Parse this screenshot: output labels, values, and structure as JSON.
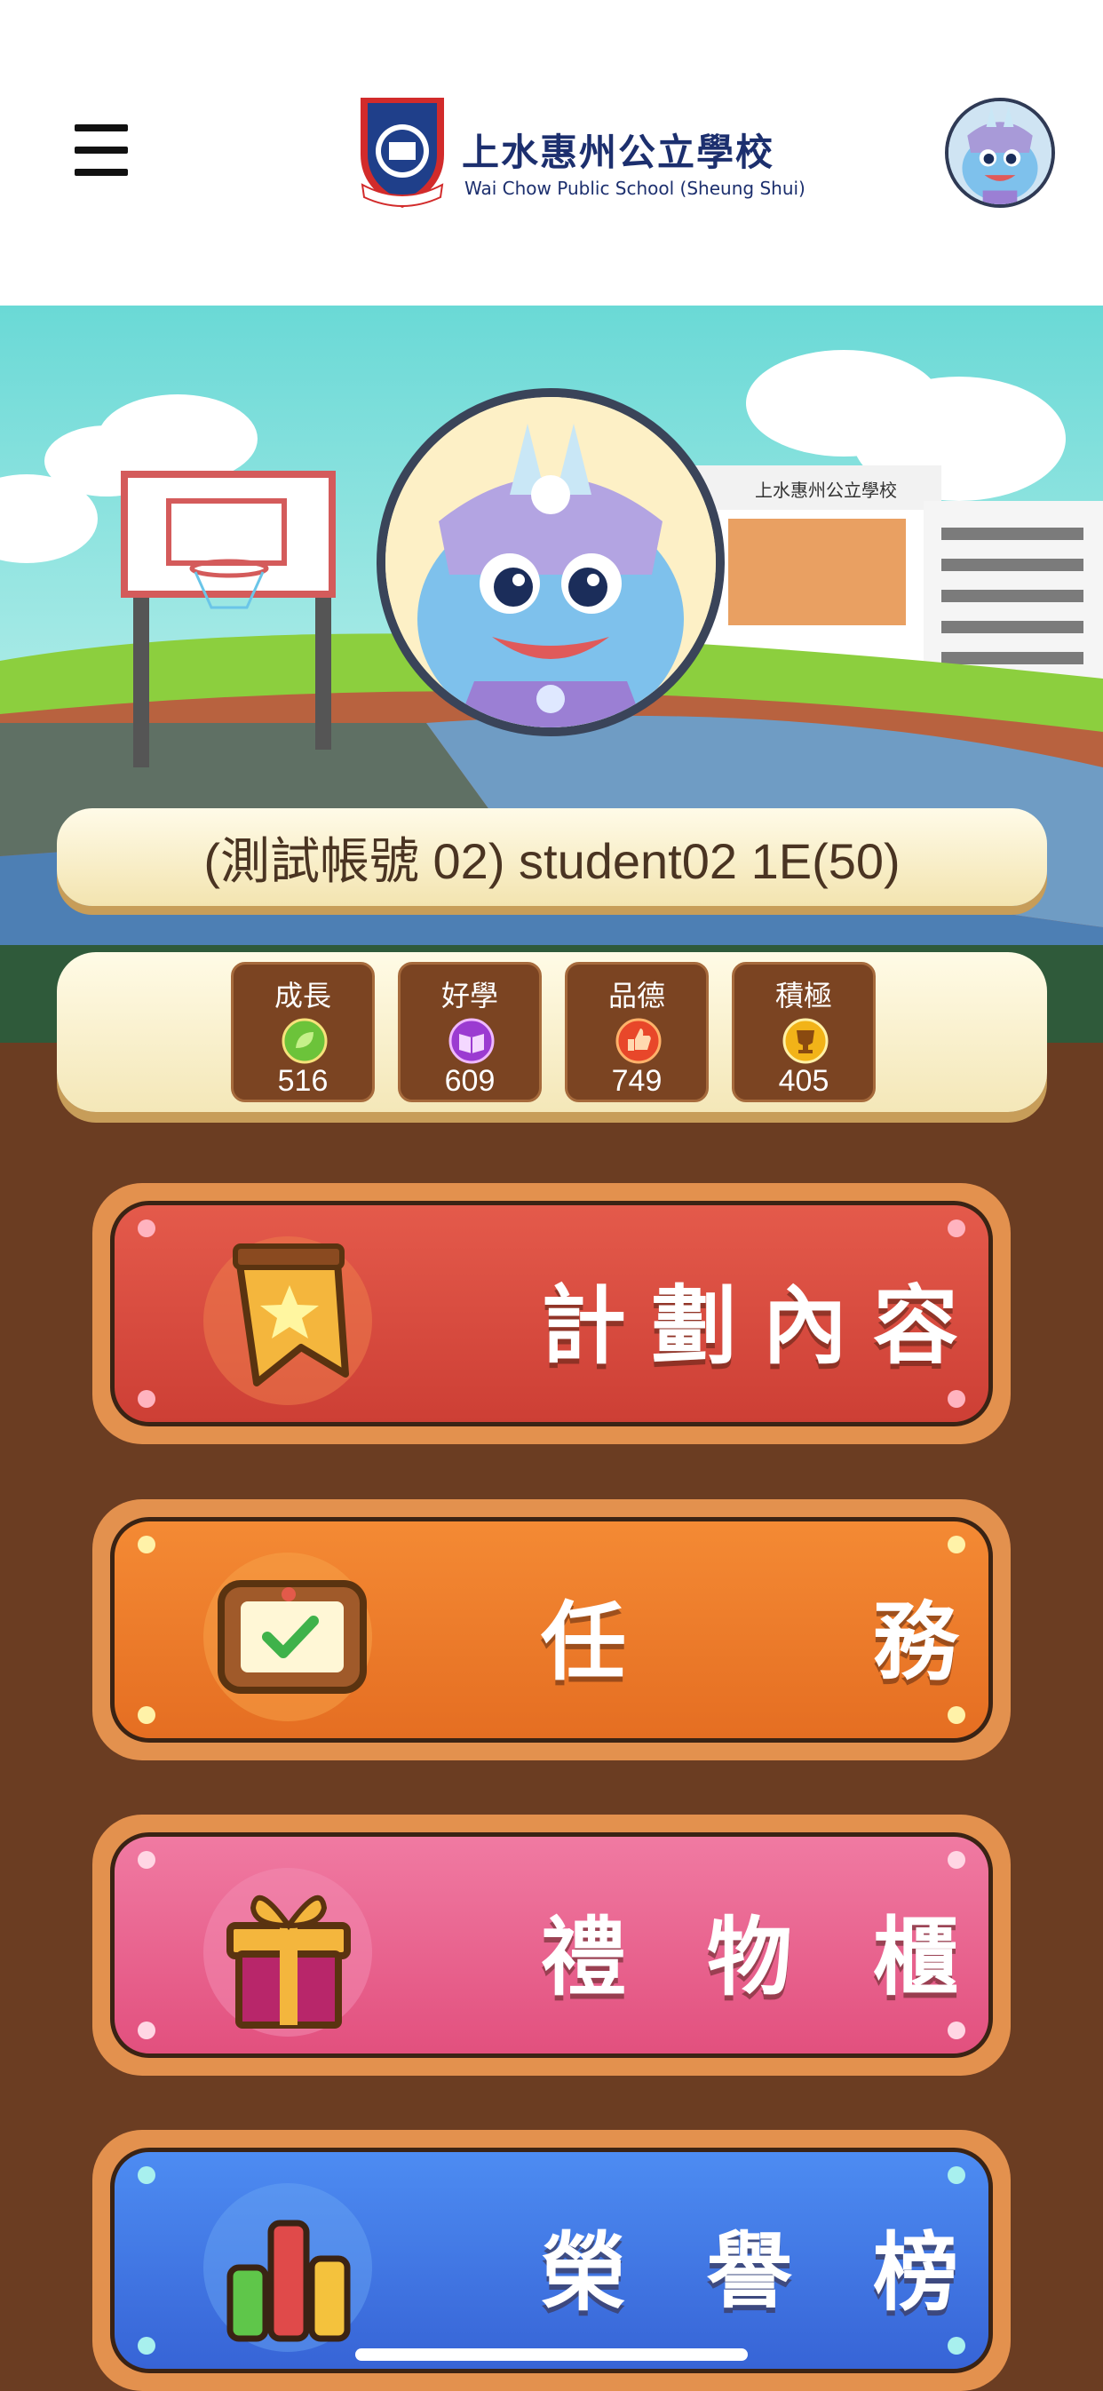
{
  "header": {
    "school_name_zh": "上水惠州公立學校",
    "school_name_en": "Wai Chow Public School (Sheung Shui)",
    "menu_icon": "hamburger-menu-icon",
    "profile_icon": "dragon-avatar-icon"
  },
  "scene": {
    "building_sign": "上水惠州公立學校"
  },
  "student": {
    "display_name": "(測試帳號 02) student02 1E(50)"
  },
  "stats": [
    {
      "label": "成長",
      "value": "516",
      "icon": "leaf-icon",
      "color": "#6cc33a"
    },
    {
      "label": "好學",
      "value": "609",
      "icon": "book-icon",
      "color": "#9b3bd1"
    },
    {
      "label": "品德",
      "value": "749",
      "icon": "thumbs-up-icon",
      "color": "#e8472a"
    },
    {
      "label": "積極",
      "value": "405",
      "icon": "trophy-icon",
      "color": "#f2b318"
    }
  ],
  "buttons": [
    {
      "label": [
        "計",
        "劃",
        "內",
        "容"
      ],
      "icon": "star-banner-icon",
      "color": "#d6483b"
    },
    {
      "label": [
        "任",
        "務"
      ],
      "icon": "task-board-icon",
      "color": "#ec7a2a"
    },
    {
      "label": [
        "禮",
        "物",
        "櫃"
      ],
      "icon": "gift-icon",
      "color": "#e9648e"
    },
    {
      "label": [
        "榮",
        "譽",
        "榜"
      ],
      "icon": "bar-chart-icon",
      "color": "#3f78e6"
    }
  ],
  "colors": {
    "background": "#6b3d22",
    "header": "#ffffff",
    "brand_navy": "#1c2f6e"
  }
}
